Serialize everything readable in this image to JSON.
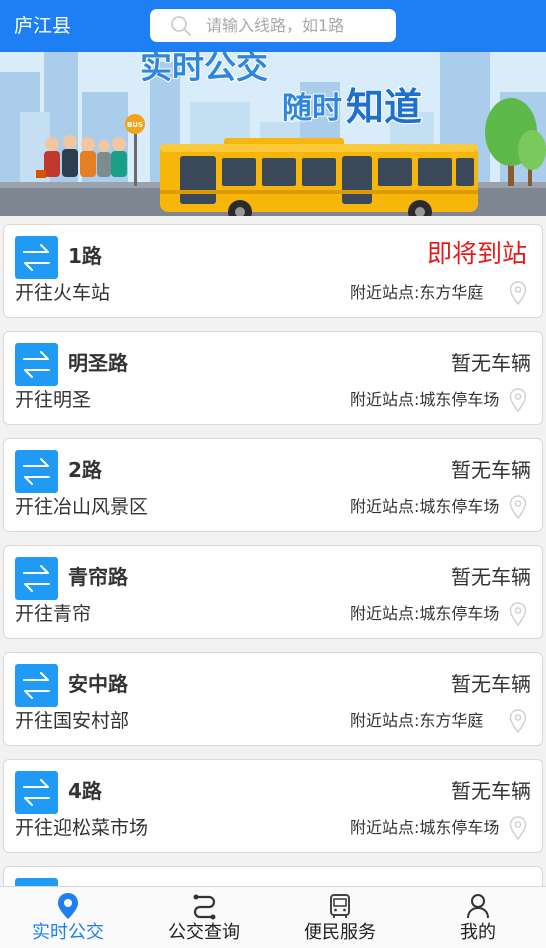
{
  "header": {
    "city": "庐江县",
    "search_placeholder": "请输入线路，如1路",
    "search_icon": "search-icon"
  },
  "banner": {
    "line1": "实时公交",
    "line2_a": "随时",
    "line2_b": "知道",
    "bus_stop_sign": "BUS"
  },
  "routes": [
    {
      "name": "1路",
      "destination": "开往火车站",
      "status": "即将到站",
      "nearby_stop": "附近站点:东方华庭"
    },
    {
      "name": "明圣路",
      "destination": "开往明圣",
      "status": "暂无车辆",
      "nearby_stop": "附近站点:城东停车场"
    },
    {
      "name": "2路",
      "destination": "开往冶山风景区",
      "status": "暂无车辆",
      "nearby_stop": "附近站点:城东停车场"
    },
    {
      "name": "青帘路",
      "destination": "开往青帘",
      "status": "暂无车辆",
      "nearby_stop": "附近站点:城东停车场"
    },
    {
      "name": "安中路",
      "destination": "开往国安村部",
      "status": "暂无车辆",
      "nearby_stop": "附近站点:东方华庭"
    },
    {
      "name": "4路",
      "destination": "开往迎松菜市场",
      "status": "暂无车辆",
      "nearby_stop": "附近站点:城东停车场"
    }
  ],
  "nav": [
    {
      "label": "实时公交",
      "icon": "location-pin-icon",
      "active": true
    },
    {
      "label": "公交查询",
      "icon": "route-icon",
      "active": false
    },
    {
      "label": "便民服务",
      "icon": "bus-icon",
      "active": false
    },
    {
      "label": "我的",
      "icon": "user-icon",
      "active": false
    }
  ],
  "colors": {
    "primary": "#1e7ff4",
    "route_icon_bg": "#1f9af5",
    "arriving": "#e51a1a",
    "bus_yellow": "#f7b70a"
  }
}
